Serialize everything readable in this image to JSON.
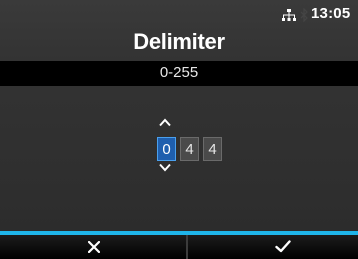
{
  "status": {
    "time": "13:05",
    "icons": [
      "network-icon",
      "bluetooth-icon"
    ]
  },
  "screen": {
    "title": "Delimiter",
    "range": "0-255"
  },
  "editor": {
    "digits": [
      "0",
      "4",
      "4"
    ],
    "active_index": 0,
    "active_color": "#1f5fae",
    "up_icon": "chevron-up-icon",
    "down_icon": "chevron-down-icon"
  },
  "buttons": {
    "cancel_icon": "close-icon",
    "ok_icon": "checkmark-icon",
    "accent_color": "#1fb5ea"
  }
}
